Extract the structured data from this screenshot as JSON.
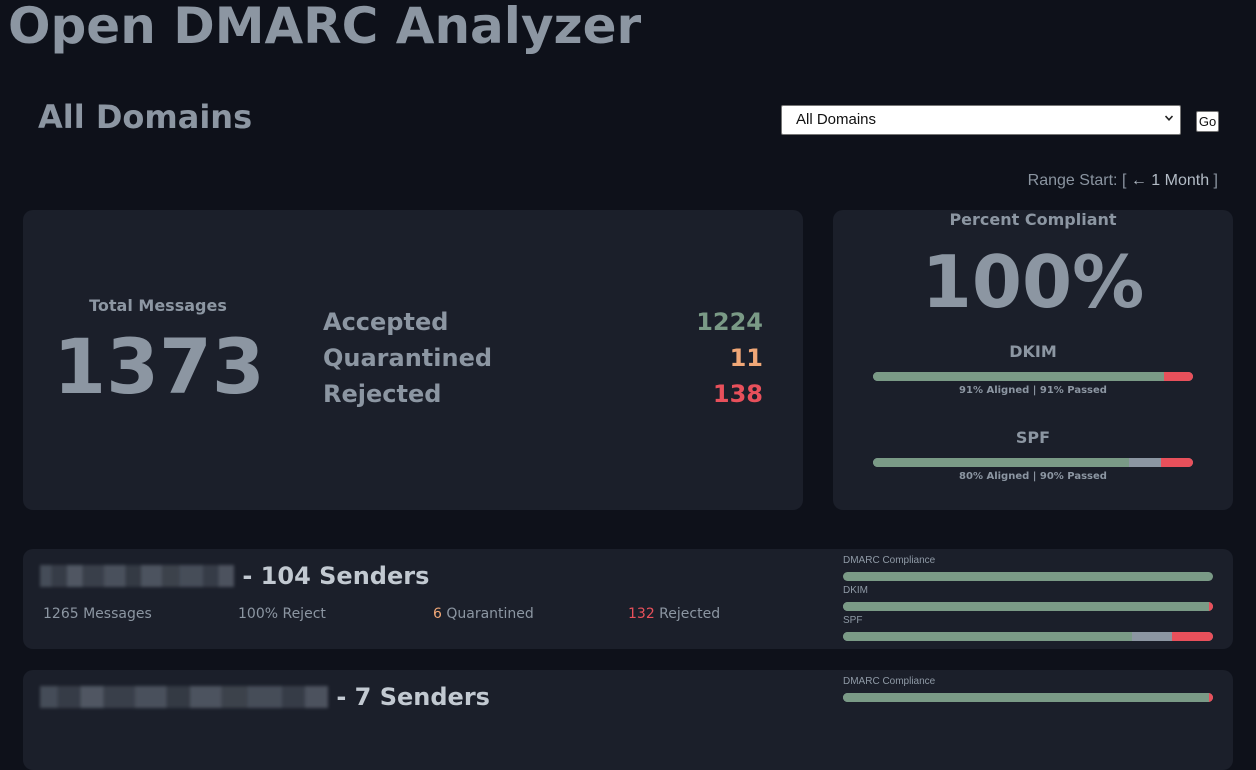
{
  "app": {
    "title": "Open DMARC Analyzer"
  },
  "page": {
    "title": "All Domains"
  },
  "filter": {
    "selected": "All Domains",
    "go_label": "Go"
  },
  "range": {
    "prefix": "Range Start: [ ",
    "link": "← 1 Month",
    "suffix": " ]"
  },
  "summary": {
    "total_label": "Total Messages",
    "total_value": "1373",
    "dispositions": [
      {
        "label": "Accepted",
        "value": "1224",
        "color": "#7a9a86"
      },
      {
        "label": "Quarantined",
        "value": "11",
        "color": "#f0a777"
      },
      {
        "label": "Rejected",
        "value": "138",
        "color": "#e8505b"
      }
    ]
  },
  "compliance": {
    "label": "Percent Compliant",
    "value": "100%",
    "dkim": {
      "title": "DKIM",
      "caption": "91% Aligned | 91% Passed",
      "aligned_pct": 91,
      "passed_pct": 91
    },
    "spf": {
      "title": "SPF",
      "caption": "80% Aligned | 90% Passed",
      "aligned_pct": 80,
      "passed_pct": 90
    }
  },
  "colors": {
    "aligned": "#7a9a86",
    "passed": "#8c96a2",
    "failed": "#e8505b",
    "quarantine": "#f0a777"
  },
  "domains": [
    {
      "senders": " - 104 Senders",
      "messages": "1265 Messages",
      "policy": "100% Reject",
      "quarantined_count": "6",
      "quarantined_label": " Quarantined",
      "rejected_count": "132",
      "rejected_label": " Rejected",
      "bars": [
        {
          "label": "DMARC Compliance",
          "aligned": 100,
          "passed": 0
        },
        {
          "label": "DKIM",
          "aligned": 99,
          "passed": 0
        },
        {
          "label": "SPF",
          "aligned": 78,
          "passed": 11
        }
      ]
    },
    {
      "senders": " - 7 Senders",
      "bars": [
        {
          "label": "DMARC Compliance",
          "aligned": 99,
          "passed": 0
        }
      ]
    }
  ]
}
